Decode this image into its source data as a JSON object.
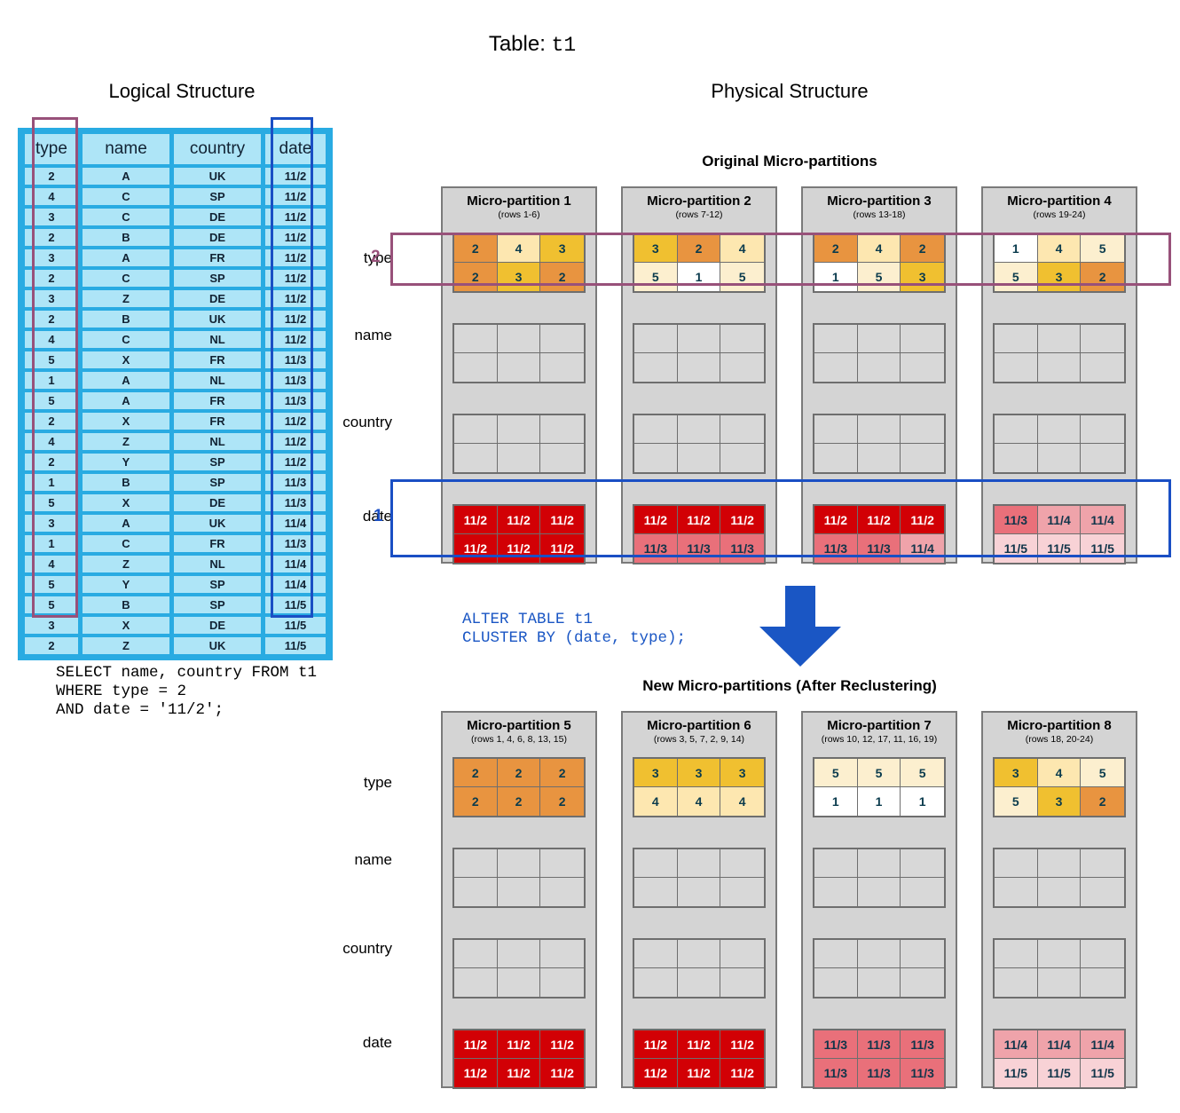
{
  "title": {
    "prefix": "Table:",
    "table": "t1"
  },
  "sections": {
    "logical": "Logical Structure",
    "physical": "Physical Structure",
    "original": "Original Micro-partitions",
    "new": "New Micro-partitions (After Reclustering)"
  },
  "logical_table": {
    "columns": [
      "type",
      "name",
      "country",
      "date"
    ],
    "rows": [
      [
        "2",
        "A",
        "UK",
        "11/2"
      ],
      [
        "4",
        "C",
        "SP",
        "11/2"
      ],
      [
        "3",
        "C",
        "DE",
        "11/2"
      ],
      [
        "2",
        "B",
        "DE",
        "11/2"
      ],
      [
        "3",
        "A",
        "FR",
        "11/2"
      ],
      [
        "2",
        "C",
        "SP",
        "11/2"
      ],
      [
        "3",
        "Z",
        "DE",
        "11/2"
      ],
      [
        "2",
        "B",
        "UK",
        "11/2"
      ],
      [
        "4",
        "C",
        "NL",
        "11/2"
      ],
      [
        "5",
        "X",
        "FR",
        "11/3"
      ],
      [
        "1",
        "A",
        "NL",
        "11/3"
      ],
      [
        "5",
        "A",
        "FR",
        "11/3"
      ],
      [
        "2",
        "X",
        "FR",
        "11/2"
      ],
      [
        "4",
        "Z",
        "NL",
        "11/2"
      ],
      [
        "2",
        "Y",
        "SP",
        "11/2"
      ],
      [
        "1",
        "B",
        "SP",
        "11/3"
      ],
      [
        "5",
        "X",
        "DE",
        "11/3"
      ],
      [
        "3",
        "A",
        "UK",
        "11/4"
      ],
      [
        "1",
        "C",
        "FR",
        "11/3"
      ],
      [
        "4",
        "Z",
        "NL",
        "11/4"
      ],
      [
        "5",
        "Y",
        "SP",
        "11/4"
      ],
      [
        "5",
        "B",
        "SP",
        "11/5"
      ],
      [
        "3",
        "X",
        "DE",
        "11/5"
      ],
      [
        "2",
        "Z",
        "UK",
        "11/5"
      ]
    ]
  },
  "sql": {
    "select": "SELECT name, country FROM t1\nWHERE type = 2\nAND date = '11/2';",
    "alter": "ALTER TABLE t1\nCLUSTER BY (date, type);"
  },
  "row_labels": [
    "type",
    "name",
    "country",
    "date"
  ],
  "markers": {
    "date": "1",
    "type": "2"
  },
  "original_partitions": [
    {
      "name": "Micro-partition 1",
      "rows": "(rows 1-6)",
      "type": [
        "2",
        "4",
        "3",
        "2",
        "3",
        "2"
      ],
      "date": [
        "11/2",
        "11/2",
        "11/2",
        "11/2",
        "11/2",
        "11/2"
      ]
    },
    {
      "name": "Micro-partition 2",
      "rows": "(rows 7-12)",
      "type": [
        "3",
        "2",
        "4",
        "5",
        "1",
        "5"
      ],
      "date": [
        "11/2",
        "11/2",
        "11/2",
        "11/3",
        "11/3",
        "11/3"
      ]
    },
    {
      "name": "Micro-partition 3",
      "rows": "(rows 13-18)",
      "type": [
        "2",
        "4",
        "2",
        "1",
        "5",
        "3"
      ],
      "date": [
        "11/2",
        "11/2",
        "11/2",
        "11/3",
        "11/3",
        "11/4"
      ]
    },
    {
      "name": "Micro-partition 4",
      "rows": "(rows 19-24)",
      "type": [
        "1",
        "4",
        "5",
        "5",
        "3",
        "2"
      ],
      "date": [
        "11/3",
        "11/4",
        "11/4",
        "11/5",
        "11/5",
        "11/5"
      ]
    }
  ],
  "new_partitions": [
    {
      "name": "Micro-partition 5",
      "rows": "(rows 1, 4, 6, 8, 13, 15)",
      "type": [
        "2",
        "2",
        "2",
        "2",
        "2",
        "2"
      ],
      "date": [
        "11/2",
        "11/2",
        "11/2",
        "11/2",
        "11/2",
        "11/2"
      ]
    },
    {
      "name": "Micro-partition 6",
      "rows": "(rows 3, 5, 7, 2, 9, 14)",
      "type": [
        "3",
        "3",
        "3",
        "4",
        "4",
        "4"
      ],
      "date": [
        "11/2",
        "11/2",
        "11/2",
        "11/2",
        "11/2",
        "11/2"
      ]
    },
    {
      "name": "Micro-partition 7",
      "rows": "(rows 10, 12, 17, 11, 16, 19)",
      "type": [
        "5",
        "5",
        "5",
        "1",
        "1",
        "1"
      ],
      "date": [
        "11/3",
        "11/3",
        "11/3",
        "11/3",
        "11/3",
        "11/3"
      ]
    },
    {
      "name": "Micro-partition 8",
      "rows": "(rows 18, 20-24)",
      "type": [
        "3",
        "4",
        "5",
        "5",
        "3",
        "2"
      ],
      "date": [
        "11/4",
        "11/4",
        "11/4",
        "11/5",
        "11/5",
        "11/5"
      ]
    }
  ],
  "colors": {
    "logical_fill": "#AEE5F7",
    "logical_border": "#29ABE2",
    "type_highlight": "#98517A",
    "date_highlight": "#1A4FC4",
    "arrow": "#1A56C4",
    "partition_bg": "#D4D4D4"
  }
}
